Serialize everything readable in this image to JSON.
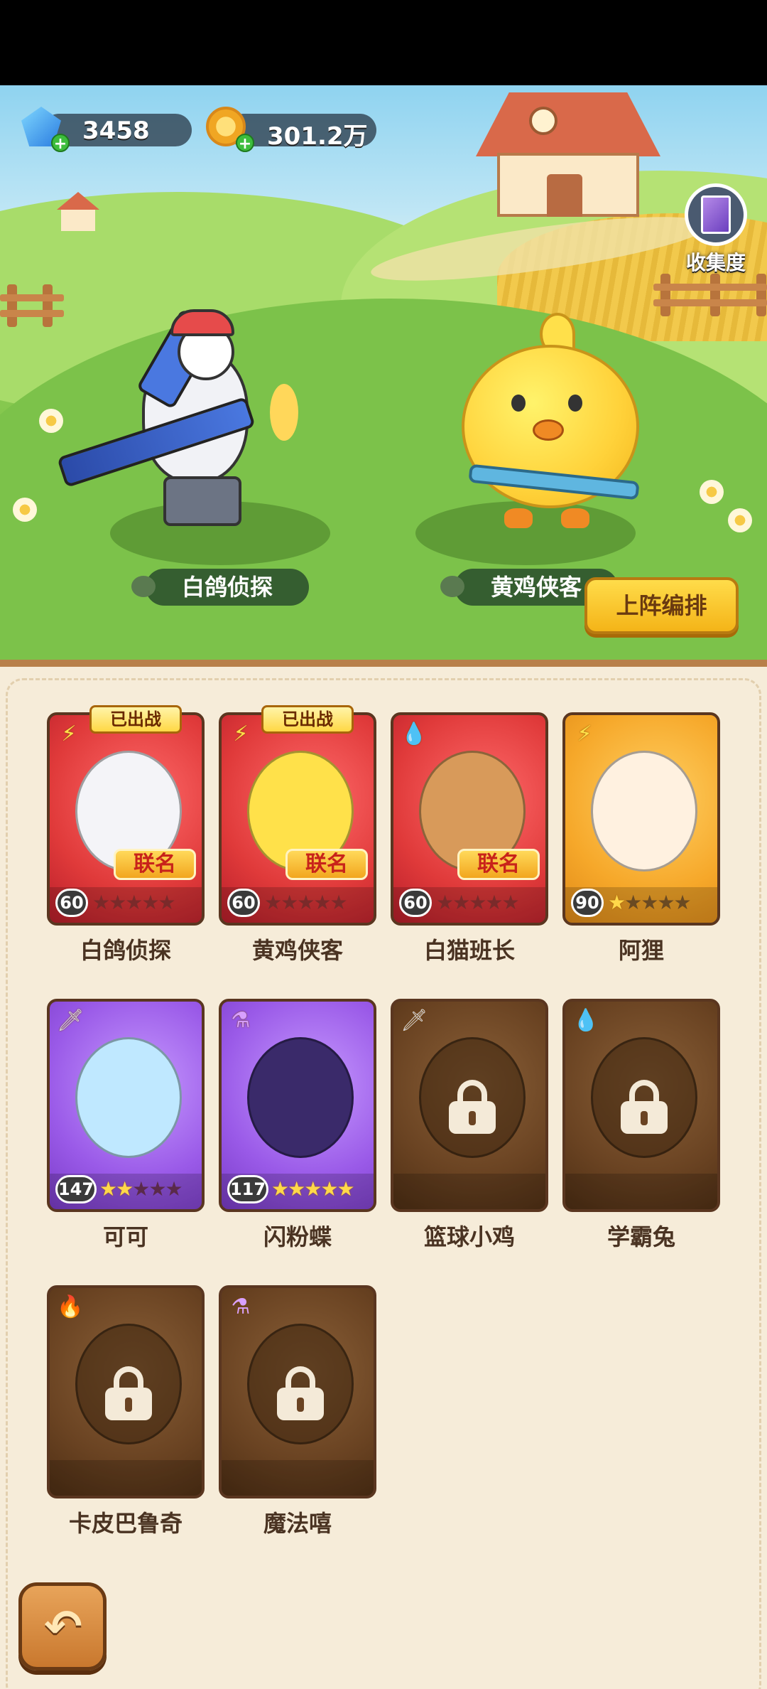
{
  "resources": {
    "gems": {
      "value": "3458",
      "icon": "diamond-icon",
      "color": "#2a7be0"
    },
    "coins": {
      "value": "301.2万",
      "icon": "coin-icon",
      "color": "#f0a623"
    }
  },
  "collection": {
    "label": "收集度",
    "icon": "book-icon"
  },
  "scene": {
    "left_character": "白鸽侦探",
    "right_character": "黄鸡侠客",
    "lineup_button": "上阵编排"
  },
  "deployed_label": "已出战",
  "collab_label": "联名",
  "cards": [
    {
      "name": "白鸽侦探",
      "level": "60",
      "rarity": "red",
      "element": "lightning-icon",
      "deployed": true,
      "collab": true,
      "stars": 0
    },
    {
      "name": "黄鸡侠客",
      "level": "60",
      "rarity": "red",
      "element": "lightning-icon",
      "deployed": true,
      "collab": true,
      "stars": 0
    },
    {
      "name": "白猫班长",
      "level": "60",
      "rarity": "red",
      "element": "water-drop-icon",
      "deployed": false,
      "collab": true,
      "stars": 0
    },
    {
      "name": "阿狸",
      "level": "90",
      "rarity": "orange",
      "element": "lightning-icon",
      "deployed": false,
      "collab": false,
      "stars": 1
    },
    {
      "name": "可可",
      "level": "147",
      "rarity": "purple",
      "element": "sword-icon",
      "deployed": false,
      "collab": false,
      "stars": 2
    },
    {
      "name": "闪粉蝶",
      "level": "117",
      "rarity": "purple",
      "element": "potion-icon",
      "deployed": false,
      "collab": false,
      "stars": 5
    },
    {
      "name": "篮球小鸡",
      "rarity": "locked",
      "element": "sword-icon",
      "locked": true
    },
    {
      "name": "学霸兔",
      "rarity": "locked",
      "element": "water-drop-icon",
      "locked": true
    },
    {
      "name": "卡皮巴鲁奇",
      "rarity": "locked",
      "element": "fire-icon",
      "locked": true
    },
    {
      "name": "魔法嘻",
      "rarity": "locked",
      "element": "potion-icon",
      "locked": true
    }
  ],
  "back_button": {
    "icon": "back-arrow-icon"
  }
}
